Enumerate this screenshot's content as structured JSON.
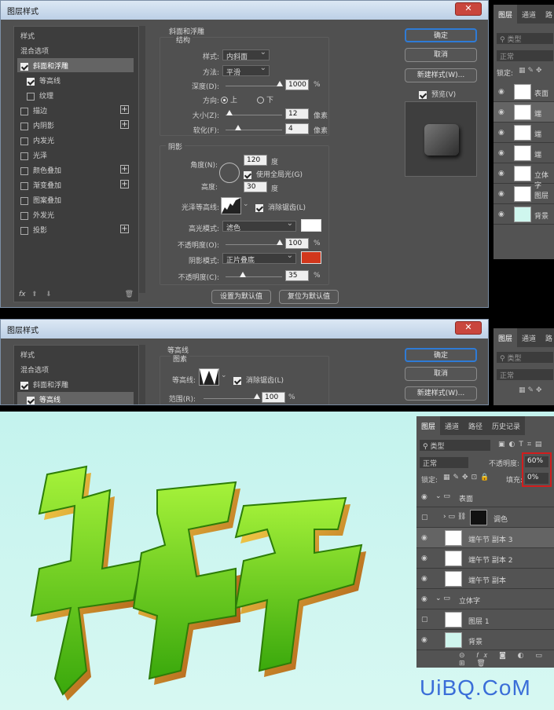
{
  "dialog1": {
    "title": "图层样式",
    "close": "✕",
    "left_header": "样式",
    "blend_options": "混合选项",
    "items": [
      {
        "label": "斜面和浮雕",
        "checked": true,
        "selected": true,
        "plus": false
      },
      {
        "label": "等高线",
        "checked": true,
        "selected": false,
        "plus": false,
        "indent": true
      },
      {
        "label": "纹理",
        "checked": false,
        "selected": false,
        "plus": false,
        "indent": true
      },
      {
        "label": "描边",
        "checked": false,
        "plus": true
      },
      {
        "label": "内阴影",
        "checked": false,
        "plus": true
      },
      {
        "label": "内发光",
        "checked": false,
        "plus": false
      },
      {
        "label": "光泽",
        "checked": false,
        "plus": false
      },
      {
        "label": "颜色叠加",
        "checked": false,
        "plus": true
      },
      {
        "label": "渐变叠加",
        "checked": false,
        "plus": true
      },
      {
        "label": "图案叠加",
        "checked": false,
        "plus": false
      },
      {
        "label": "外发光",
        "checked": false,
        "plus": false
      },
      {
        "label": "投影",
        "checked": false,
        "plus": true
      }
    ],
    "fx": "fx",
    "bevel": {
      "group_title": "斜面和浮雕",
      "structure_title": "结构",
      "style_label": "样式:",
      "style_value": "内斜面",
      "method_label": "方法:",
      "method_value": "平滑",
      "depth_label": "深度(D):",
      "depth_value": "1000",
      "depth_unit": "%",
      "direction_label": "方向:",
      "dir_up": "上",
      "dir_down": "下",
      "size_label": "大小(Z):",
      "size_value": "12",
      "size_unit": "像素",
      "soften_label": "软化(F):",
      "soften_value": "4",
      "soften_unit": "像素"
    },
    "shading": {
      "title": "阴影",
      "angle_label": "角度(N):",
      "angle_value": "120",
      "angle_unit": "度",
      "global_light": "使用全局光(G)",
      "altitude_label": "高度:",
      "altitude_value": "30",
      "altitude_unit": "度",
      "gloss_label": "光泽等高线:",
      "antialias": "消除锯齿(L)",
      "highlight_mode_label": "高光模式:",
      "highlight_mode_value": "滤色",
      "highlight_color": "#ffffff",
      "highlight_opacity_label": "不透明度(O):",
      "highlight_opacity_value": "100",
      "highlight_opacity_unit": "%",
      "shadow_mode_label": "阴影模式:",
      "shadow_mode_value": "正片叠底",
      "shadow_color": "#d2371c",
      "shadow_opacity_label": "不透明度(C):",
      "shadow_opacity_value": "35",
      "shadow_opacity_unit": "%"
    },
    "default_btn": "设置为默认值",
    "reset_btn": "复位为默认值",
    "ok": "确定",
    "cancel": "取消",
    "new_style": "新建样式(W)...",
    "preview": "预览(V)"
  },
  "dialog2": {
    "title": "图层样式",
    "close": "✕",
    "left_header": "样式",
    "blend_options": "混合选项",
    "items": [
      {
        "label": "斜面和浮雕",
        "checked": true,
        "selected": false
      },
      {
        "label": "等高线",
        "checked": true,
        "selected": true
      }
    ],
    "contour_group": "等高线",
    "element_title": "图素",
    "contour_label": "等高线:",
    "antialias": "消除锯齿(L)",
    "range_label": "范围(R):",
    "range_value": "100",
    "range_unit": "%",
    "ok": "确定",
    "cancel": "取消",
    "new_style": "新建样式(W)..."
  },
  "layers_small_1": {
    "tabs": [
      "图层",
      "通道",
      "路"
    ],
    "kind": "类型",
    "blend": "正常",
    "lock": "锁定:",
    "layers": [
      "表面",
      "端",
      "端",
      "端",
      "立体字",
      "图层",
      "背景"
    ]
  },
  "layers_small_2": {
    "tabs": [
      "图层",
      "通道",
      "路"
    ],
    "kind": "类型",
    "blend": "正常"
  },
  "layers_main": {
    "tabs": [
      "图层",
      "通道",
      "路径",
      "历史记录"
    ],
    "kind": "类型",
    "blend": "正常",
    "opacity_label": "不透明度:",
    "opacity_value": "60%",
    "lock_label": "锁定:",
    "fill_label": "填充:",
    "fill_value": "0%",
    "layers": [
      {
        "name": "表面",
        "type": "group"
      },
      {
        "name": "调色",
        "type": "group-child"
      },
      {
        "name": "端午节 副本 3",
        "type": "layer",
        "selected": true
      },
      {
        "name": "端午节 副本 2",
        "type": "layer"
      },
      {
        "name": "端午节 副本",
        "type": "layer"
      },
      {
        "name": "立体字",
        "type": "group"
      },
      {
        "name": "图层 1",
        "type": "layer"
      },
      {
        "name": "背景",
        "type": "bg"
      }
    ]
  },
  "artwork": {
    "text": "端午节",
    "watermark": "UiBQ.CoM"
  }
}
